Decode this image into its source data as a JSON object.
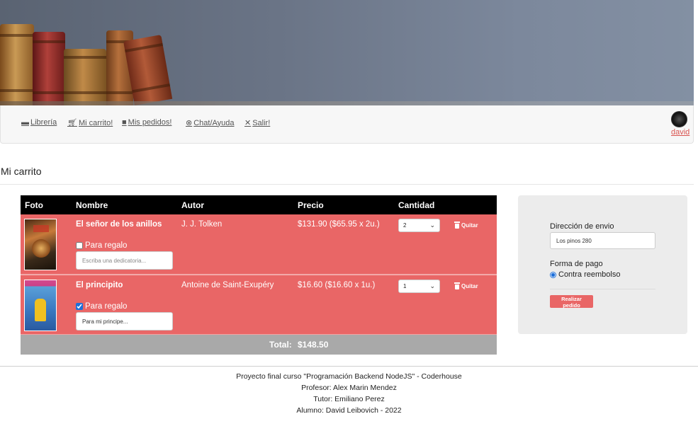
{
  "nav": {
    "items": [
      {
        "label": "Librería",
        "icon": "book-icon"
      },
      {
        "label": "Mi carrito!",
        "icon": "cart-icon"
      },
      {
        "label": "Mis pedidos!",
        "icon": "truck-icon"
      },
      {
        "label": "Chat/Ayuda",
        "icon": "help-circle-icon"
      },
      {
        "label": "Salir!",
        "icon": "close-icon"
      }
    ],
    "user": "david"
  },
  "page_title": "Mi carrito",
  "table": {
    "headers": [
      "Foto",
      "Nombre",
      "Autor",
      "Precio",
      "Cantidad"
    ],
    "rows": [
      {
        "name": "El señor de los anillos",
        "author": "J. J. Tolken",
        "price": "$131.90 ($65.95 x 2u.)",
        "gift_label": "Para regalo",
        "gift_checked": false,
        "dedication_value": "",
        "dedication_placeholder": "Escriba una dedicatoria...",
        "quantity": "2",
        "remove_label": "Quitar"
      },
      {
        "name": "El principito",
        "author": "Antoine de Saint-Exupéry",
        "price": "$16.60 ($16.60 x 1u.)",
        "gift_label": "Para regalo",
        "gift_checked": true,
        "dedication_value": "Para mi principe...",
        "dedication_placeholder": "Escriba una dedicatoria...",
        "quantity": "1",
        "remove_label": "Quitar"
      }
    ],
    "total_label": "Total:",
    "total_value": "$148.50"
  },
  "checkout": {
    "address_label": "Dirección de envio",
    "address_value": "Los pinos 280",
    "payment_label": "Forma de pago",
    "payment_option": "Contra reembolso",
    "submit_label": "Realizar pedido"
  },
  "footer": {
    "lines": [
      "Proyecto final curso \"Programación Backend NodeJS\" - Coderhouse",
      "Profesor: Alex Marin Mendez",
      "Tutor: Emiliano Perez",
      "Alumno: David Leibovich - 2022"
    ]
  },
  "colors": {
    "row_bg": "#e96666",
    "header_bg": "#000000",
    "total_bg": "#a9a9a9",
    "accent": "#d9534f"
  }
}
